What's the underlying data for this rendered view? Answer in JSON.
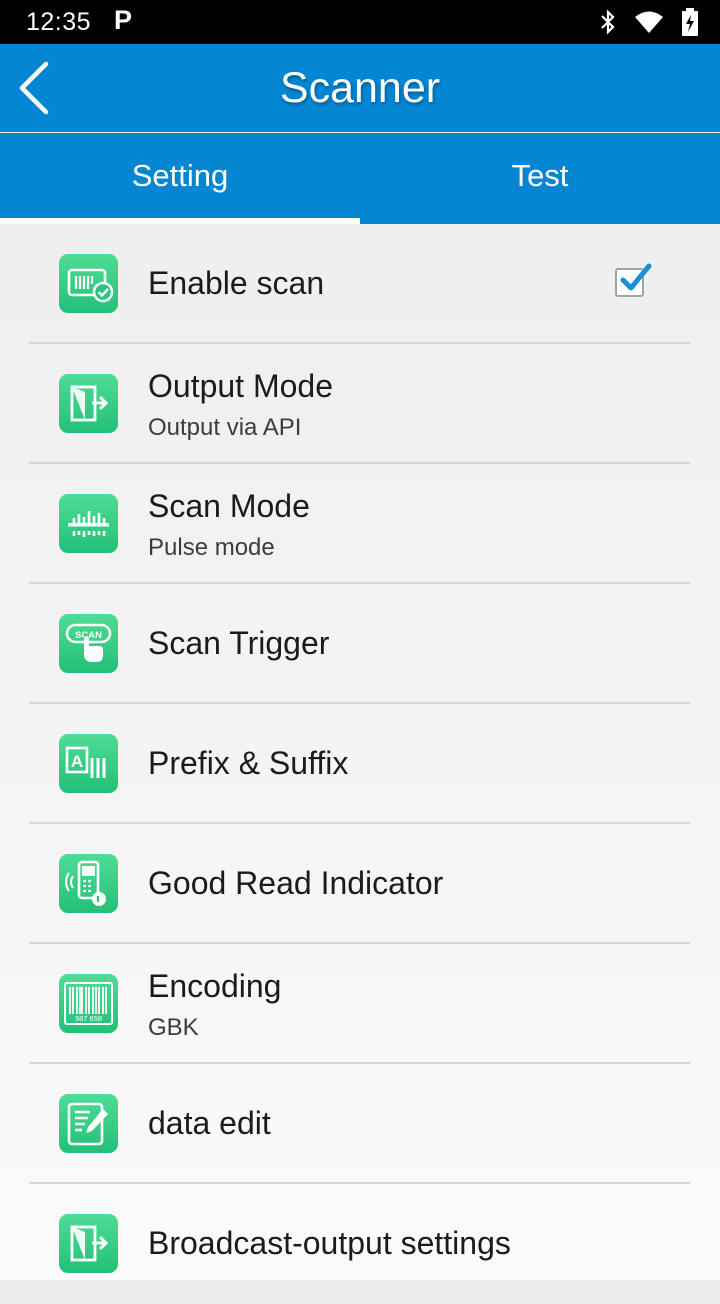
{
  "status_bar": {
    "time": "12:35",
    "notification_letter": "P",
    "icons": [
      "bluetooth-icon",
      "wifi-icon",
      "battery-charging-icon"
    ]
  },
  "app_bar": {
    "title": "Scanner",
    "back_icon": "chevron-left-icon"
  },
  "tabs": [
    {
      "label": "Setting",
      "active": true
    },
    {
      "label": "Test",
      "active": false
    }
  ],
  "settings": [
    {
      "title": "Enable scan",
      "icon": "scan-check-icon",
      "checkbox": true,
      "checked": true
    },
    {
      "title": "Output Mode",
      "subtitle": "Output via API",
      "icon": "output-icon"
    },
    {
      "title": "Scan Mode",
      "subtitle": "Pulse mode",
      "icon": "scan-mode-icon"
    },
    {
      "title": "Scan Trigger",
      "icon": "scan-trigger-icon"
    },
    {
      "title": "Prefix & Suffix",
      "icon": "prefix-suffix-icon"
    },
    {
      "title": "Good Read Indicator",
      "icon": "good-read-indicator-icon"
    },
    {
      "title": "Encoding",
      "subtitle": "GBK",
      "icon": "barcode-icon",
      "icon_text": "987 658"
    },
    {
      "title": "data edit",
      "icon": "data-edit-icon"
    },
    {
      "title": "Broadcast-output settings",
      "icon": "broadcast-output-icon"
    }
  ],
  "colors": {
    "primary": "#0486d3",
    "icon_green": "#2fc97e",
    "checkbox_blue": "#1a8fd8"
  }
}
